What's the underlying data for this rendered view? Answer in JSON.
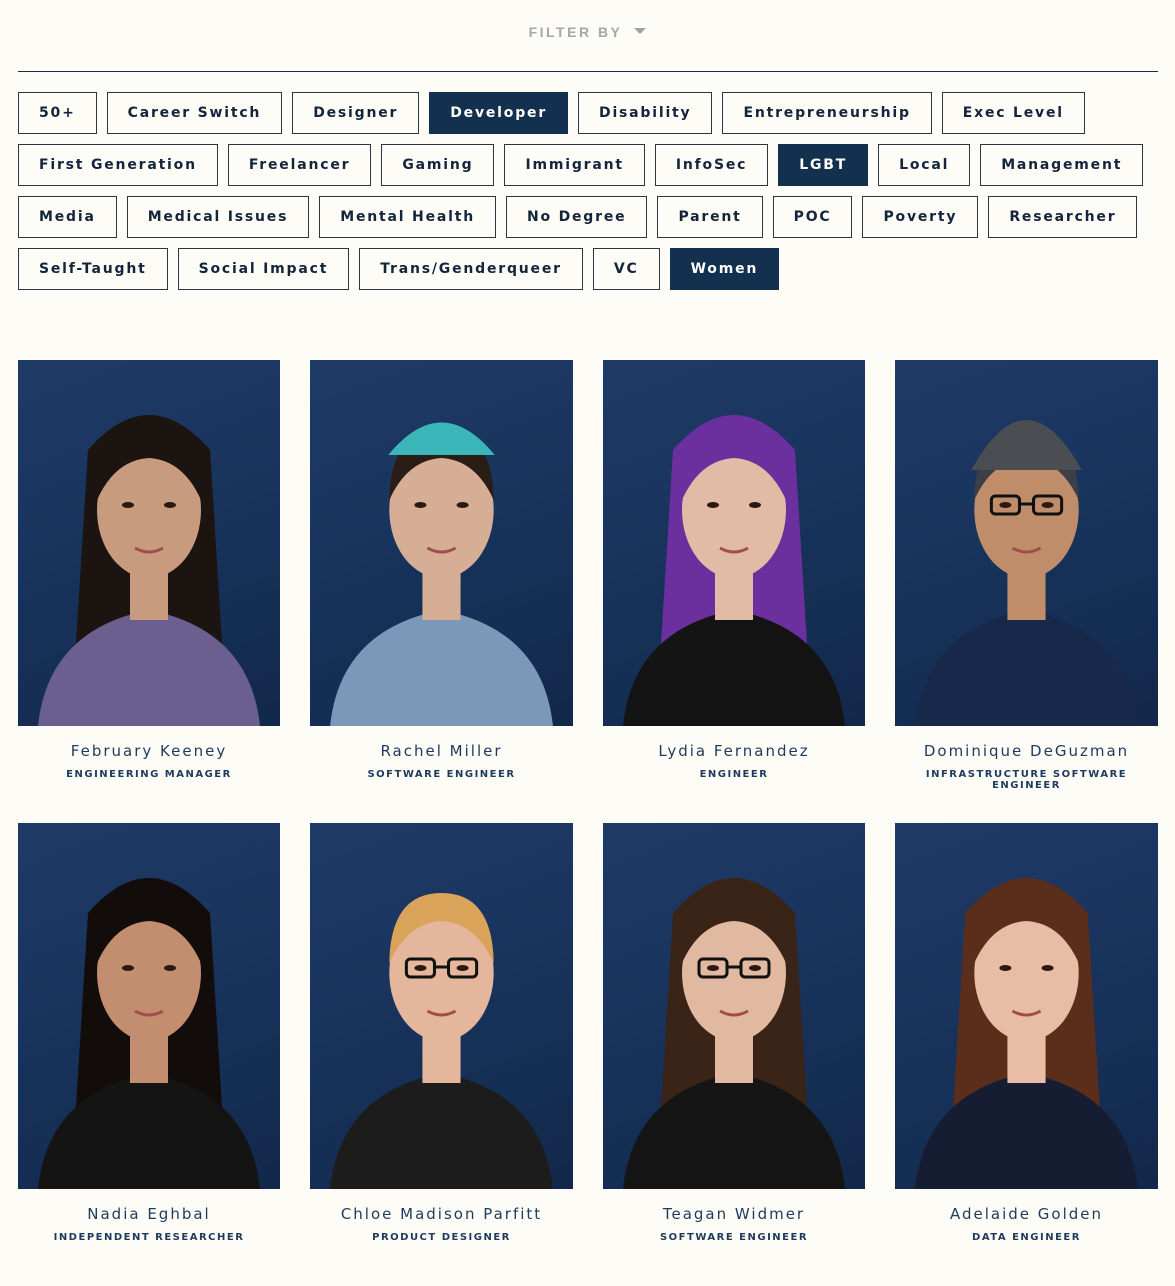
{
  "filter": {
    "label": "FILTER BY",
    "caret_icon": "chevron-down-icon"
  },
  "tags": [
    {
      "label": "50+",
      "active": false
    },
    {
      "label": "Career Switch",
      "active": false
    },
    {
      "label": "Designer",
      "active": false
    },
    {
      "label": "Developer",
      "active": true
    },
    {
      "label": "Disability",
      "active": false
    },
    {
      "label": "Entrepreneurship",
      "active": false
    },
    {
      "label": "Exec Level",
      "active": false
    },
    {
      "label": "First Generation",
      "active": false
    },
    {
      "label": "Freelancer",
      "active": false
    },
    {
      "label": "Gaming",
      "active": false
    },
    {
      "label": "Immigrant",
      "active": false
    },
    {
      "label": "InfoSec",
      "active": false
    },
    {
      "label": "LGBT",
      "active": true
    },
    {
      "label": "Local",
      "active": false
    },
    {
      "label": "Management",
      "active": false
    },
    {
      "label": "Media",
      "active": false
    },
    {
      "label": "Medical Issues",
      "active": false
    },
    {
      "label": "Mental Health",
      "active": false
    },
    {
      "label": "No Degree",
      "active": false
    },
    {
      "label": "Parent",
      "active": false
    },
    {
      "label": "POC",
      "active": false
    },
    {
      "label": "Poverty",
      "active": false
    },
    {
      "label": "Researcher",
      "active": false
    },
    {
      "label": "Self-Taught",
      "active": false
    },
    {
      "label": "Social Impact",
      "active": false
    },
    {
      "label": "Trans/Genderqueer",
      "active": false
    },
    {
      "label": "VC",
      "active": false
    },
    {
      "label": "Women",
      "active": true
    }
  ],
  "people": [
    {
      "name": "February Keeney",
      "role": "ENGINEERING MANAGER"
    },
    {
      "name": "Rachel Miller",
      "role": "SOFTWARE ENGINEER"
    },
    {
      "name": "Lydia Fernandez",
      "role": "ENGINEER"
    },
    {
      "name": "Dominique DeGuzman",
      "role": "INFRASTRUCTURE SOFTWARE ENGINEER"
    },
    {
      "name": "Nadia Eghbal",
      "role": "INDEPENDENT RESEARCHER"
    },
    {
      "name": "Chloe Madison Parfitt",
      "role": "PRODUCT DESIGNER"
    },
    {
      "name": "Teagan Widmer",
      "role": "SOFTWARE ENGINEER"
    },
    {
      "name": "Adelaide Golden",
      "role": "DATA ENGINEER"
    }
  ],
  "colors": {
    "background": "#fdfcf7",
    "accent": "#13304f",
    "portrait_backdrop": "#1f3a66"
  }
}
